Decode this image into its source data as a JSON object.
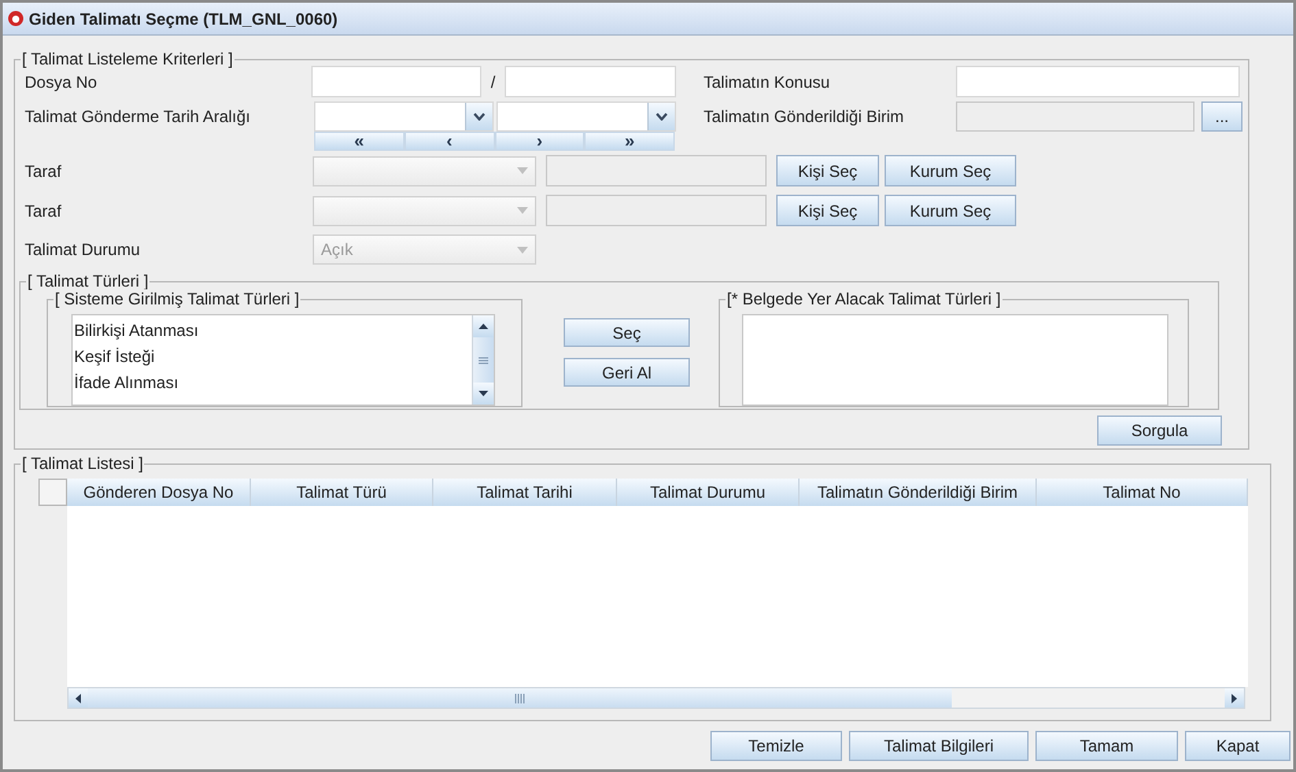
{
  "window": {
    "title": "Giden Talimatı Seçme (TLM_GNL_0060)"
  },
  "criteria": {
    "legend": "[ Talimat Listeleme Kriterleri ]",
    "dosya_no": {
      "label": "Dosya No",
      "separator": "/"
    },
    "konu": {
      "label": "Talimatın Konusu"
    },
    "tarih": {
      "label": "Talimat Gönderme Tarih Aralığı",
      "nav": [
        "«",
        "‹",
        "›",
        "»"
      ]
    },
    "birim": {
      "label": "Talimatın Gönderildiği Birim",
      "button": "..."
    },
    "taraf": [
      {
        "label": "Taraf",
        "disabled": true,
        "buttons": [
          "Kişi Seç",
          "Kurum Seç"
        ]
      },
      {
        "label": "Taraf",
        "disabled": true,
        "buttons": [
          "Kişi Seç",
          "Kurum Seç"
        ]
      }
    ],
    "durum": {
      "label": "Talimat Durumu",
      "value": "Açık",
      "disabled": true
    }
  },
  "types": {
    "legend": "[ Talimat Türleri ]",
    "available": {
      "legend": "[ Sisteme Girilmiş Talimat Türleri ]",
      "items": [
        "Bilirkişi Atanması",
        "Keşif İsteği",
        "İfade Alınması"
      ]
    },
    "buttons": [
      "Seç",
      "Geri Al"
    ],
    "chosen": {
      "legend": "[* Belgede Yer Alacak Talimat Türleri ]"
    }
  },
  "query_button": "Sorgula",
  "list": {
    "legend": "[ Talimat Listesi ]",
    "columns": [
      "Gönderen Dosya No",
      "Talimat Türü",
      "Talimat Tarihi",
      "Talimat Durumu",
      "Talimatın Gönderildiği Birim",
      "Talimat No"
    ]
  },
  "buttons": [
    "Temizle",
    "Talimat Bilgileri",
    "Tamam",
    "Kapat"
  ]
}
